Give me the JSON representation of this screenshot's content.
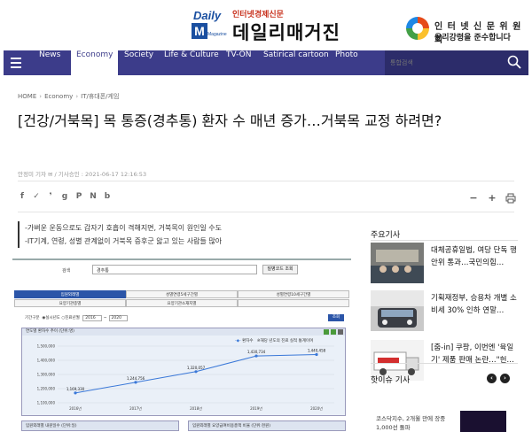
{
  "masthead": {
    "logo_top": "Daily",
    "logo_letter": "M",
    "logo_sub": "Magazine",
    "tagline": "인터넷경제신문",
    "brand": "데일리매거진",
    "ethics_line1": "인 터 넷 신 문 위 원 회",
    "ethics_line2": "윤리강령을 준수합니다"
  },
  "nav": {
    "items": [
      "News",
      "Economy",
      "Society",
      "Life & Culture",
      "TV-ON",
      "Satirical cartoon",
      "Photo"
    ],
    "search_placeholder": "통합검색"
  },
  "breadcrumb": {
    "home": "HOME",
    "section": "Economy",
    "sub": "IT/휴대폰/게임"
  },
  "article": {
    "title": "[건강/거북목] 목 통증(경추통) 환자 수 매년 증가…거북목 교정 하려면?",
    "byline": "안정미 기자 ✉ / 기사승인 : 2021-06-17 12:16:53",
    "summary": [
      "-가벼운 운동으로도 갑자기 호흡이 격해지면, 거북목이 원인일 수도",
      "-IT기계, 연령, 성별 관계없이 거북목 증후군 앓고 있는 사람들 많아"
    ]
  },
  "share_icons": [
    "facebook-icon",
    "twitter-icon",
    "kakao-icon",
    "googleplus-icon",
    "pinterest-icon",
    "naver-icon",
    "band-icon"
  ],
  "tools": {
    "minus": "−",
    "plus": "+"
  },
  "embedded": {
    "search_label": "검색",
    "search_value": "경추통",
    "search_button": "질병코드 조회",
    "tabs_row1": [
      "입원외래별",
      "성별연령5세구간별",
      "성별연령10세구간별"
    ],
    "tabs_row2": [
      "요양기관종별",
      "요양기관소재지별",
      ""
    ],
    "period_label": "기간구분",
    "period_opt1": "실시년도",
    "period_opt2": "진료년월",
    "period_from": "2016",
    "period_to": "2020",
    "look_button": "조회",
    "chart_head": "연도별 환자수 추이 (단위:명)",
    "legend_series": "환자수",
    "legend_note": "※해당 년도의 진료 실적 통계이며",
    "low_left": "입원외래별 내원일수 (단위:일)",
    "low_right": "입원외래별 요양급여비용총액 비율 (단위:천원)"
  },
  "chart_data": {
    "type": "line",
    "title": "연도별 환자수 추이 (단위:명)",
    "categories": [
      "2016년",
      "2017년",
      "2018년",
      "2019년",
      "2020년"
    ],
    "series": [
      {
        "name": "환자수",
        "values": [
          1169330,
          1244756,
          1320057,
          1430734,
          1440458
        ]
      }
    ],
    "value_labels": [
      "1,169,330",
      "1,244,756",
      "1,320,057",
      "1,430,734",
      "1,440,458"
    ],
    "ylim": [
      1100000,
      1500000
    ],
    "yticks": [
      "1,500,000",
      "1,400,000",
      "1,300,000",
      "1,200,000",
      "1,100,000"
    ],
    "ytick_values": [
      1500000,
      1400000,
      1300000,
      1200000,
      1100000
    ],
    "color": "#3a78d8",
    "legend": "top-right",
    "grid": true
  },
  "sidebar": {
    "title": "주요기사",
    "items": [
      "대체공휴일법, 여당 단독 행안위 통과…국민의힘…",
      "기획재정부, 승용차 개별 소비세 30% 인하 연말…",
      "[줌-in] 쿠팡, 이번엔 '육일기' 제품 판매 논란…\"헌…"
    ],
    "hot_title": "핫이슈 기사",
    "hot_text_1": "코스닥지수, 2개월 만에 장중",
    "hot_text_2": "1,000선 돌파"
  },
  "colors": {
    "nav": "#3c3c8a",
    "accent": "#c8321e",
    "series": "#3a78d8"
  }
}
